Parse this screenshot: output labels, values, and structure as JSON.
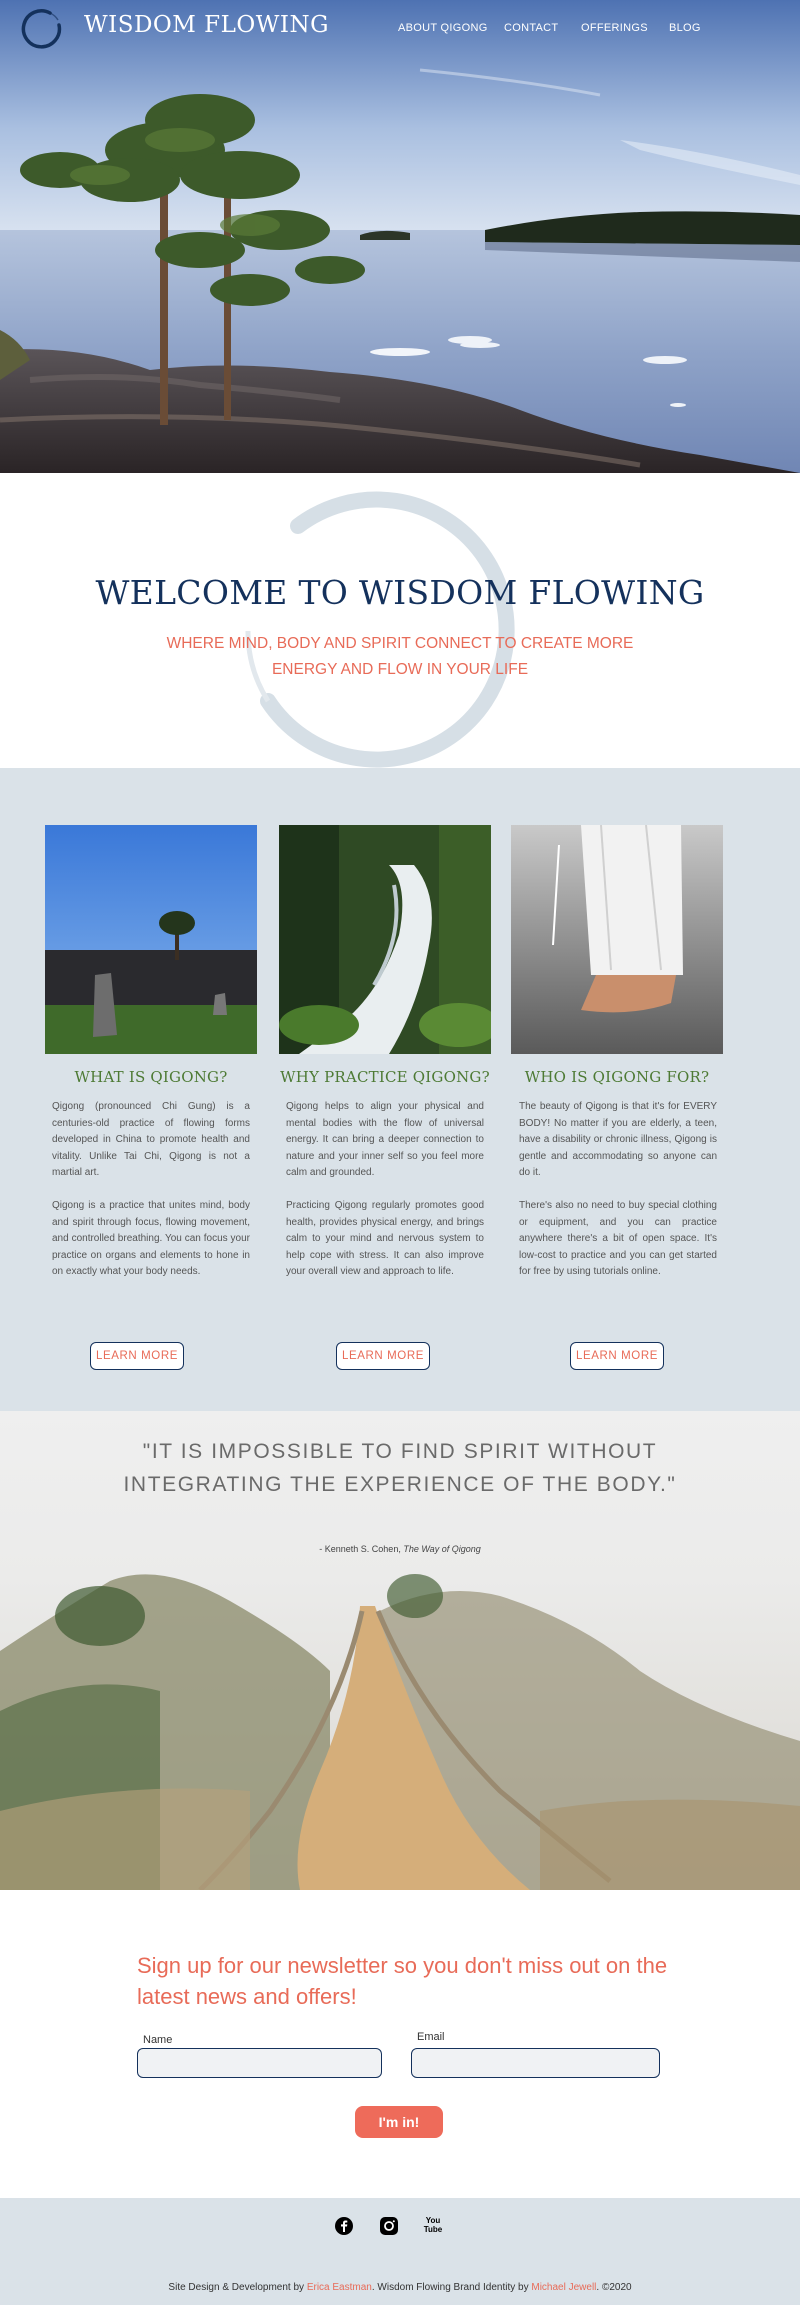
{
  "header": {
    "site_title": "WISDOM FLOWING",
    "nav": [
      "ABOUT QIGONG",
      "CONTACT",
      "OFFERINGS",
      "BLOG"
    ]
  },
  "welcome": {
    "title": "WELCOME TO WISDOM FLOWING",
    "subtitle": "WHERE MIND, BODY AND SPIRIT CONNECT TO CREATE MORE ENERGY AND FLOW IN YOUR LIFE"
  },
  "features": [
    {
      "title": "WHAT IS QIGONG?",
      "paragraphs": [
        "Qigong (pronounced Chi Gung) is a centuries-old practice of flowing forms developed in China to promote health and vitality. Unlike Tai Chi, Qigong is not a martial art.",
        "Qigong is a practice that unites mind, body and spirit through focus, flowing movement, and controlled breathing. You can focus your practice on organs and elements to hone in on exactly what your body needs."
      ],
      "button": "LEARN MORE"
    },
    {
      "title": "WHY PRACTICE QIGONG?",
      "paragraphs": [
        "Qigong helps to align your physical and mental bodies with the flow of universal energy. It can bring a deeper connection to nature and your inner self so you feel more calm and grounded.",
        "Practicing Qigong regularly promotes good health, provides physical energy, and brings calm to your mind and nervous system to help cope with stress. It can also improve your overall view and approach to life."
      ],
      "button": "LEARN MORE"
    },
    {
      "title": "WHO IS QIGONG FOR?",
      "paragraphs": [
        "The beauty of Qigong is that it's for EVERY BODY! No matter if you are elderly, a teen, have a disability or chronic illness, Qigong is gentle and accommodating so anyone can do it.",
        "There's also no need to buy special clothing or equipment, and you can practice anywhere there's a bit of open space. It's low-cost to practice and you can get started for free by using tutorials online."
      ],
      "button": "LEARN MORE"
    }
  ],
  "quote": {
    "text": "\"IT IS IMPOSSIBLE TO FIND SPIRIT WITHOUT INTEGRATING THE EXPERIENCE OF THE BODY.\"",
    "author": "- Kenneth S. Cohen,",
    "book": "The Way of Qigong"
  },
  "newsletter": {
    "heading": "Sign up for our newsletter so you don't miss out on the latest news and offers!",
    "name_label": "Name",
    "email_label": "Email",
    "name_value": "",
    "email_value": "",
    "submit_label": "I'm in!"
  },
  "footer": {
    "social_icons": [
      "facebook-icon",
      "instagram-icon",
      "youtube-icon"
    ],
    "youtube_text": "You Tube",
    "prefix": "Site Design & Development by",
    "designer": "Erica Eastman",
    "middle": ". Wisdom Flowing Brand Identity by",
    "brand_designer": "Michael Jewell",
    "suffix": ". ©2020"
  },
  "colors": {
    "navy": "#14315c",
    "coral": "#e86b58",
    "green": "#4d7a34",
    "pale_blue": "#dae2e8"
  }
}
